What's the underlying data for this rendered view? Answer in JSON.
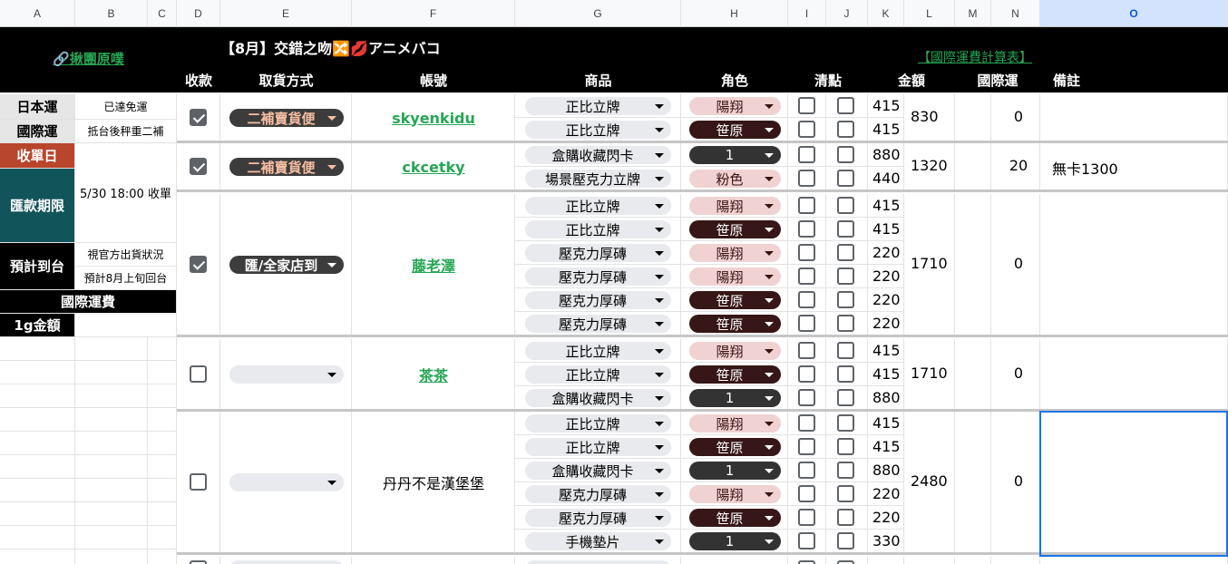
{
  "columns": [
    "A",
    "B",
    "C",
    "D",
    "E",
    "F",
    "G",
    "H",
    "I",
    "J",
    "K",
    "L",
    "M",
    "N",
    "O"
  ],
  "selected_column": "O",
  "header": {
    "top_link": "🔗揪團原噗",
    "title": "【8月】交錯之吻🔀💋アニメバコ",
    "shipping_link": "【國際運費計算表】",
    "col_labels": {
      "payment": "收款",
      "pickup": "取貨方式",
      "account": "帳號",
      "product": "商品",
      "role": "角色",
      "check": "清點",
      "amount": "金額",
      "intl": "國際運",
      "note": "備註"
    }
  },
  "info": {
    "japan_label": "日本運",
    "japan_value": "已達免運",
    "intl_label": "國際運",
    "intl_value": "抵台後秤重二補",
    "close_label": "收單日",
    "pay_label": "匯款期限",
    "pay_value": "5/30 18:00 收單",
    "eta_label": "預計到台",
    "eta_value1": "視官方出貨狀況",
    "eta_value2": "預計8月上旬回台",
    "intl_fee_label": "國際運費",
    "per_gram_label": "1g金額"
  },
  "orders": [
    {
      "paid": true,
      "pickup": "二補賣貨便",
      "account": "skyenkidu",
      "total": "830",
      "intl": "0",
      "note": "",
      "items": [
        {
          "product": "正比立牌",
          "role": "陽翔",
          "price": "415"
        },
        {
          "product": "正比立牌",
          "role": "笹原",
          "price": "415"
        }
      ]
    },
    {
      "paid": true,
      "pickup": "二補賣貨便",
      "account": "ckcetky",
      "total": "1320",
      "intl": "20",
      "note": "無卡1300",
      "items": [
        {
          "product": "盒購收藏閃卡",
          "role": "1",
          "price": "880"
        },
        {
          "product": "場景壓克力立牌",
          "role": "粉色",
          "price": "440"
        }
      ]
    },
    {
      "paid": true,
      "pickup": "匯/全家店到",
      "account": "藤老澤",
      "total": "1710",
      "intl": "0",
      "note": "",
      "items": [
        {
          "product": "正比立牌",
          "role": "陽翔",
          "price": "415"
        },
        {
          "product": "正比立牌",
          "role": "笹原",
          "price": "415"
        },
        {
          "product": "壓克力厚磚",
          "role": "陽翔",
          "price": "220"
        },
        {
          "product": "壓克力厚磚",
          "role": "陽翔",
          "price": "220"
        },
        {
          "product": "壓克力厚磚",
          "role": "笹原",
          "price": "220"
        },
        {
          "product": "壓克力厚磚",
          "role": "笹原",
          "price": "220"
        }
      ]
    },
    {
      "paid": false,
      "pickup": "",
      "account": "茶茶",
      "total": "1710",
      "intl": "0",
      "note": "",
      "items": [
        {
          "product": "正比立牌",
          "role": "陽翔",
          "price": "415"
        },
        {
          "product": "正比立牌",
          "role": "笹原",
          "price": "415"
        },
        {
          "product": "盒購收藏閃卡",
          "role": "1",
          "price": "880"
        }
      ]
    },
    {
      "paid": false,
      "pickup": "",
      "account": "丹丹不是漢堡堡",
      "total": "2480",
      "intl": "0",
      "note": "",
      "items": [
        {
          "product": "正比立牌",
          "role": "陽翔",
          "price": "415"
        },
        {
          "product": "正比立牌",
          "role": "笹原",
          "price": "415"
        },
        {
          "product": "盒購收藏閃卡",
          "role": "1",
          "price": "880"
        },
        {
          "product": "壓克力厚磚",
          "role": "陽翔",
          "price": "220"
        },
        {
          "product": "壓克力厚磚",
          "role": "笹原",
          "price": "220"
        },
        {
          "product": "手機墊片",
          "role": "1",
          "price": "330"
        }
      ]
    }
  ],
  "colors": {
    "header_bg": "#000000",
    "link_green": "#26a653",
    "close_red": "#b8462d",
    "deadline_teal": "#11545a",
    "role_pink": "#f0d2d2",
    "role_maroon": "#361616",
    "selection_blue": "#1a73e8"
  }
}
